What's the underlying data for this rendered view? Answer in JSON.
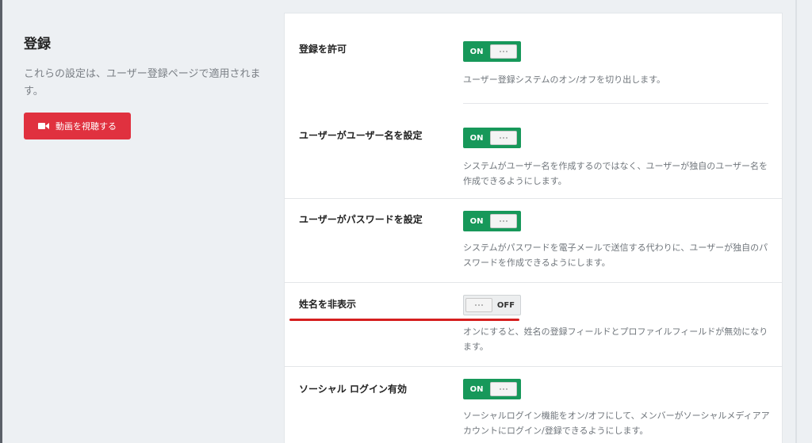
{
  "sidebar": {
    "title": "登録",
    "description": "これらの設定は、ユーザー登録ページで適用されます。",
    "video_button_label": "動画を視聴する",
    "video_button_color": "#e0313f"
  },
  "toggle_colors": {
    "on": "#17985a",
    "off": "#eceeef"
  },
  "settings": [
    {
      "label": "登録を許可",
      "state": "ON",
      "description": "ユーザー登録システムのオン/オフを切り出します。"
    },
    {
      "label": "ユーザーがユーザー名を設定",
      "state": "ON",
      "description": "システムがユーザー名を作成するのではなく、ユーザーが独自のユーザー名を作成できるようにします。"
    },
    {
      "label": "ユーザーがパスワードを設定",
      "state": "ON",
      "description": "システムがパスワードを電子メールで送信する代わりに、ユーザーが独自のパスワードを作成できるようにします。"
    },
    {
      "label": "姓名を非表示",
      "state": "OFF",
      "description": "オンにすると、姓名の登録フィールドとプロファイルフィールドが無効になります。"
    },
    {
      "label": "ソーシャル ログイン有効",
      "state": "ON",
      "description": "ソーシャルログイン機能をオン/オフにして、メンバーがソーシャルメディアアカウントにログイン/登録できるようにします。"
    }
  ],
  "annotation": {
    "color": "#d61f1f",
    "target": "姓名を非表示"
  }
}
